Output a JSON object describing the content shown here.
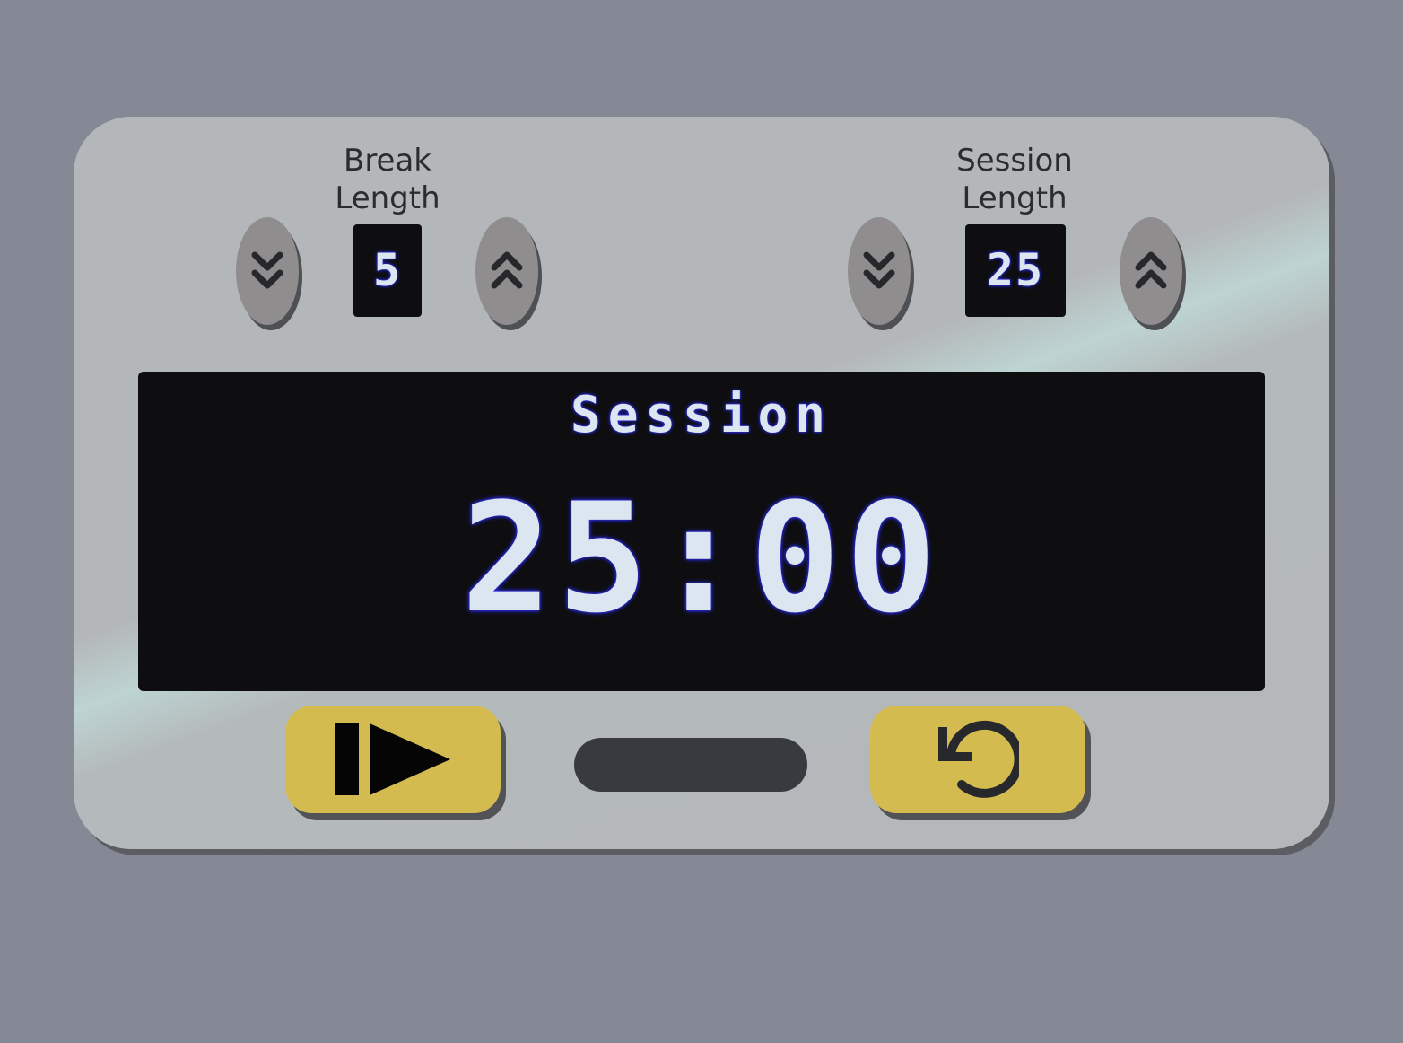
{
  "break": {
    "label_line1": "Break",
    "label_line2": "Length",
    "value": "5",
    "decrement_icon": "chevrons-down-icon",
    "increment_icon": "chevrons-up-icon"
  },
  "session": {
    "label_line1": "Session",
    "label_line2": "Length",
    "value": "25",
    "decrement_icon": "chevrons-down-icon",
    "increment_icon": "chevrons-up-icon"
  },
  "timer": {
    "label": "Session",
    "time_left": "25:00",
    "progress": 0
  },
  "controls": {
    "start_stop_icon": "play-pause-icon",
    "reset_icon": "reset-icon"
  },
  "colors": {
    "background": "#858995",
    "device": "#b4b7b9",
    "screen": "#0e0e10",
    "digits": "#dce6f0",
    "digit_glow": "#2a2aff",
    "button_yellow": "#d3bb50",
    "round_button": "#908d8e",
    "progress_track": "#373a3e"
  }
}
